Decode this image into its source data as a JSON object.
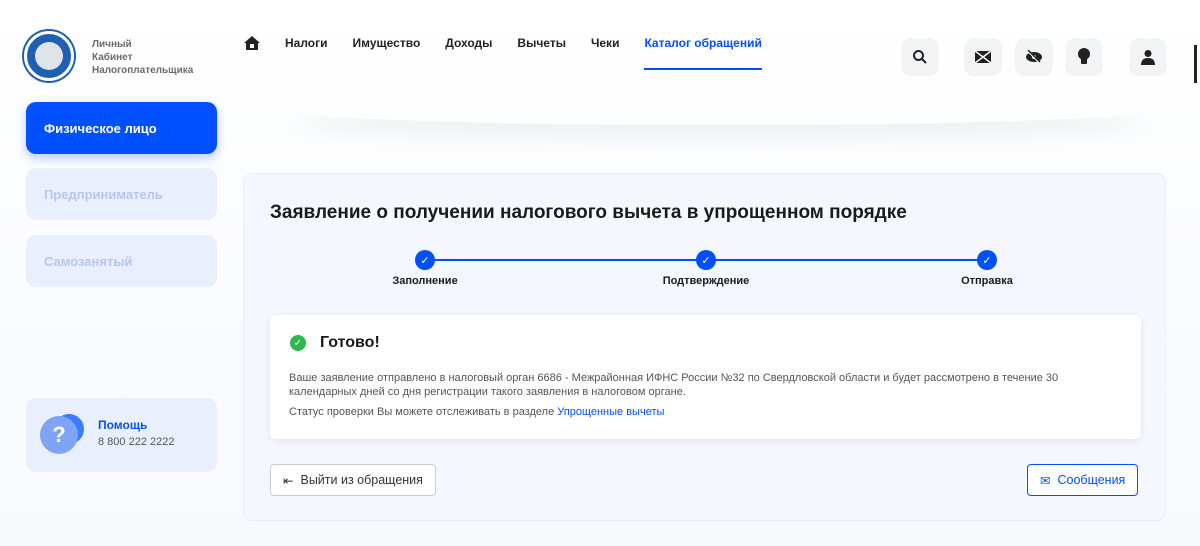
{
  "header": {
    "logo_text": [
      "Личный",
      "Кабинет",
      "Налогоплательщика"
    ],
    "nav": [
      "Налоги",
      "Имущество",
      "Доходы",
      "Вычеты",
      "Чеки",
      "Каталог обращений"
    ]
  },
  "sidebar": {
    "items": [
      "Физическое лицо",
      "Предприниматель",
      "Самозанятый"
    ],
    "help": {
      "title": "Помощь",
      "phone": "8 800 222 2222",
      "icon": "?"
    }
  },
  "main": {
    "title": "Заявление о получении налогового вычета в упрощенном порядке",
    "steps": [
      "Заполнение",
      "Подтверждение",
      "Отправка"
    ],
    "result": {
      "title": "Готово!",
      "message": "Ваше заявление отправлено в налоговый орган 6686 - Межрайонная ИФНС России №32 по Свердловской области и будет рассмотрено в течение 30 календарных дней со дня регистрации такого заявления в налоговом органе.",
      "status_text": "Статус проверки Вы можете отслеживать в разделе ",
      "status_link": "Упрощенные вычеты"
    },
    "exit_button": "Выйти из обращения",
    "messages_button": "Сообщения"
  },
  "colors": {
    "accent": "#0050ff",
    "success": "#2db84b"
  }
}
